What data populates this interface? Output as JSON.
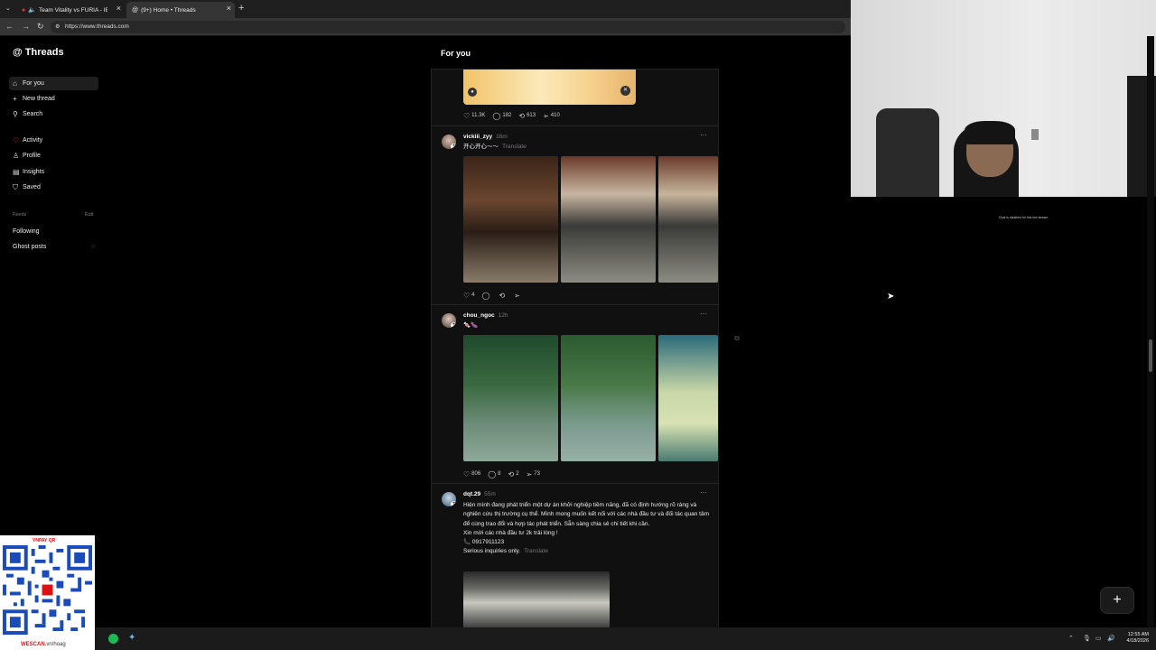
{
  "browser": {
    "tabs": [
      {
        "title": "Team Vitality vs FURIA - IEM Ri",
        "active": false
      },
      {
        "title": "(9+) Home • Threads",
        "active": true
      }
    ],
    "url": "https://www.threads.com"
  },
  "sidebar": {
    "brand": "Threads",
    "items": [
      {
        "label": "For you",
        "icon": "home-icon"
      },
      {
        "label": "New thread",
        "icon": "plus-icon"
      },
      {
        "label": "Search",
        "icon": "search-icon"
      },
      {
        "label": "Activity",
        "icon": "heart-icon"
      },
      {
        "label": "Profile",
        "icon": "person-icon"
      },
      {
        "label": "Insights",
        "icon": "chart-icon"
      },
      {
        "label": "Saved",
        "icon": "bookmark-icon"
      }
    ],
    "feeds_heading": "Feeds",
    "feeds_edit": "Edit",
    "feeds": [
      {
        "label": "Following"
      },
      {
        "label": "Ghost posts"
      }
    ]
  },
  "feed": {
    "title": "For you",
    "post0": {
      "likes": "11.3K",
      "replies": "182",
      "reposts": "613",
      "shares": "410"
    },
    "post1": {
      "username": "vickiii_zyy",
      "time": "16m",
      "text": "开心开心～～",
      "translate": "Translate",
      "likes": "4"
    },
    "post2": {
      "username": "chou_ngoc",
      "time": "12h",
      "text": "🍬🍆",
      "likes": "806",
      "replies": "8",
      "reposts": "2",
      "shares": "73"
    },
    "post3": {
      "username": "dqt.29",
      "time": "55m",
      "text": "Hiện mình đang phát triển một dự án khởi nghiệp tiềm năng, đã có định hướng rõ ràng và nghiên cứu thị trường cụ thể. Mình mong muốn kết nối với các nhà đầu tư và đối tác quan tâm để cùng trao đổi và hợp tác phát triển. Sẵn sàng chia sẻ chi tiết khi cần.",
      "line2": "Xin mời các nhà đầu tư 2k trải lòng !",
      "phone": "📞 0917911123",
      "line4": "Serious inquiries only.",
      "translate": "Translate"
    }
  },
  "overlay": {
    "chat_note": "Chat is disabled for this live stream.",
    "qr_logo": "VNPAY QR",
    "qr_brand": "WESCAN",
    "qr_brand_sub": ".vn/hoag"
  },
  "taskbar": {
    "time": "12:55 AM",
    "date": "4/18/2026"
  }
}
